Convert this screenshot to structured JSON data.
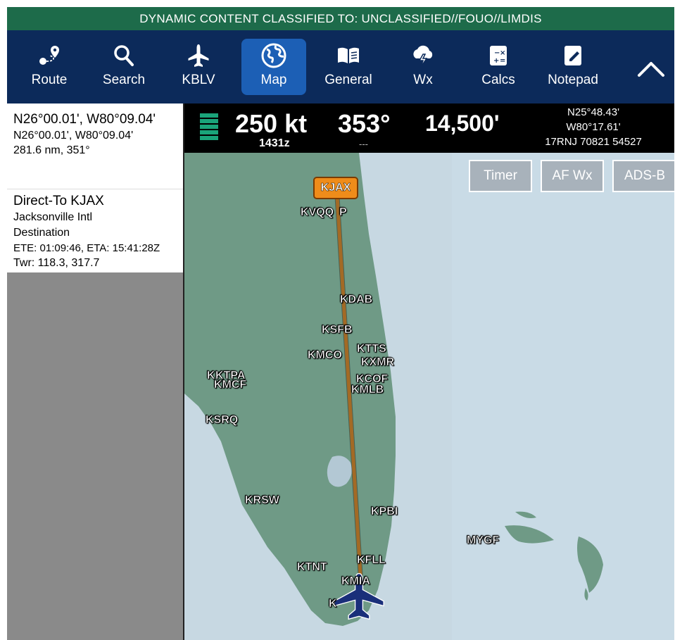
{
  "banner": {
    "text": "DYNAMIC CONTENT CLASSIFIED TO: UNCLASSIFIED//FOUO//LIMDIS"
  },
  "toolbar": {
    "items": [
      {
        "label": "Route",
        "icon": "route-icon"
      },
      {
        "label": "Search",
        "icon": "search-icon"
      },
      {
        "label": "KBLV",
        "icon": "airplane-icon"
      },
      {
        "label": "Map",
        "icon": "globe-icon",
        "active": true
      },
      {
        "label": "General",
        "icon": "book-icon"
      },
      {
        "label": "Wx",
        "icon": "weather-icon"
      },
      {
        "label": "Calcs",
        "icon": "calculator-icon"
      },
      {
        "label": "Notepad",
        "icon": "notepad-icon"
      }
    ],
    "collapse_icon": "chevron-up-icon"
  },
  "flight": {
    "speed": "250 kt",
    "time": "1431z",
    "heading": "353°",
    "heading_sub": "---",
    "altitude": "14,500'",
    "lat": "N25°48.43'",
    "lon": "W80°17.61'",
    "grid": "17RNJ 70821 54527"
  },
  "position": {
    "title": "N26°00.01', W80°09.04'",
    "coords": "N26°00.01', W80°09.04'",
    "distance": "281.6 nm, 351°"
  },
  "destination": {
    "title": "Direct-To KJAX",
    "name": "Jacksonville Intl",
    "type": "Destination",
    "ete_eta": "ETE: 01:09:46, ETA: 15:41:28Z",
    "twr": "Twr: 118.3, 317.7"
  },
  "map": {
    "buttons": {
      "timer": "Timer",
      "afwx": "AF Wx",
      "adsb": "ADS-B"
    },
    "destination_tag": "KJAX",
    "airports": {
      "kvqq": "KVQQ",
      "kvqqp": "P",
      "kdab": "KDAB",
      "ksfb": "KSFB",
      "kmco": "KMCO",
      "ktts": "KTTS",
      "kxmr": "KXMR",
      "kcof": "KCOF",
      "kmlb": "KMLB",
      "ktpa": "KTPA",
      "kmcf": "KMCF",
      "kpie": "K",
      "ksrq": "KSRQ",
      "krsw": "KRSW",
      "kpbi": "KPBI",
      "myg": "MYGF",
      "kfll": "KFLL",
      "ktnt": "KTNT",
      "kmia": "KMIA",
      "ktmb": "K"
    },
    "colors": {
      "water": "#bfd3de",
      "land": "#6f9a86",
      "route": "#a36a25"
    }
  }
}
